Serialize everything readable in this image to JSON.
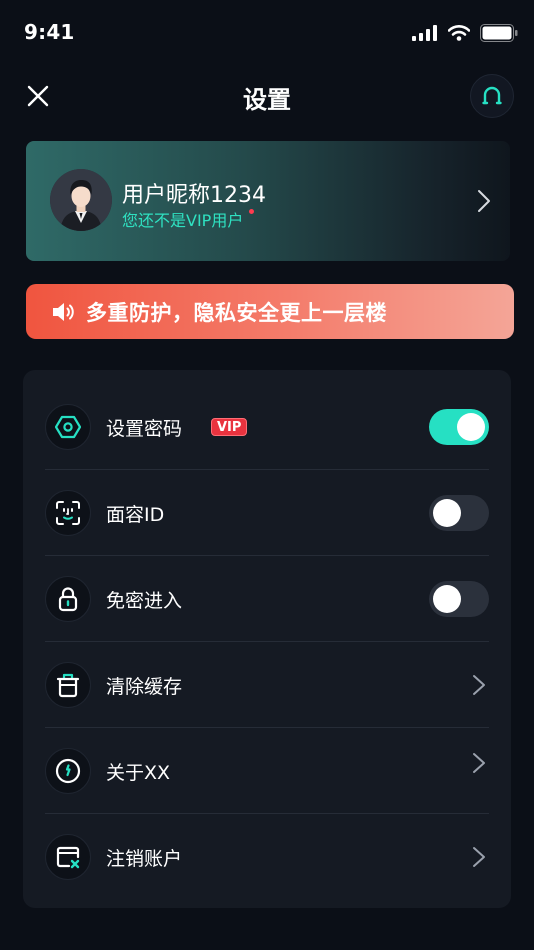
{
  "status_bar": {
    "time": "9:41"
  },
  "nav": {
    "title": "设置",
    "close_icon": "close-icon",
    "support_icon": "headset-icon"
  },
  "user": {
    "nickname": "用户昵称1234",
    "vip_status": "您还不是VIP用户"
  },
  "banner": {
    "text": "多重防护，隐私安全更上一层楼",
    "icon": "speaker-icon"
  },
  "colors": {
    "accent": "#26e0c3",
    "vip_red": "#e9333f",
    "background": "#0b0f17",
    "card": "#151a23",
    "banner_start": "#f0553f",
    "banner_end": "#f4a597"
  },
  "settings": {
    "items": [
      {
        "label": "设置密码",
        "icon": "hexagon-lock-icon",
        "badge": "VIP",
        "control": "toggle",
        "enabled": true
      },
      {
        "label": "面容ID",
        "icon": "face-id-icon",
        "control": "toggle",
        "enabled": false
      },
      {
        "label": "免密进入",
        "icon": "padlock-icon",
        "control": "toggle",
        "enabled": false
      },
      {
        "label": "清除缓存",
        "icon": "trash-icon",
        "control": "chevron"
      },
      {
        "label": "关于XX",
        "icon": "info-icon",
        "control": "chevron"
      },
      {
        "label": "注销账户",
        "icon": "account-cancel-icon",
        "control": "chevron"
      }
    ]
  }
}
